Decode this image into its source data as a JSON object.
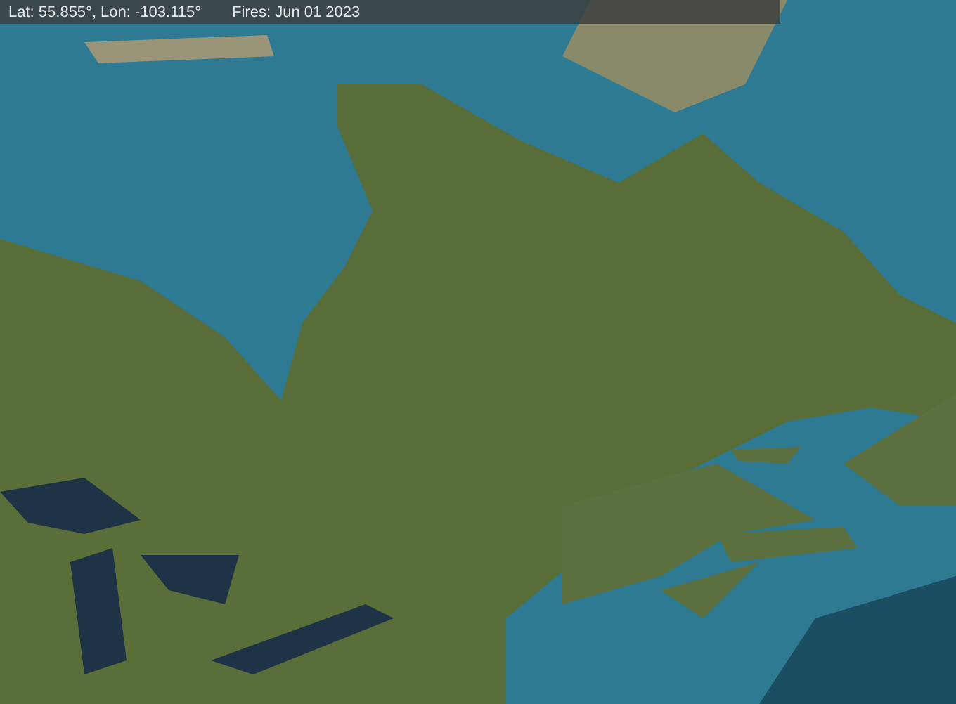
{
  "status_bar": {
    "coordinates": "Lat: 55.855°, Lon: -103.115°",
    "fires": "Fires: Jun 01 2023"
  }
}
